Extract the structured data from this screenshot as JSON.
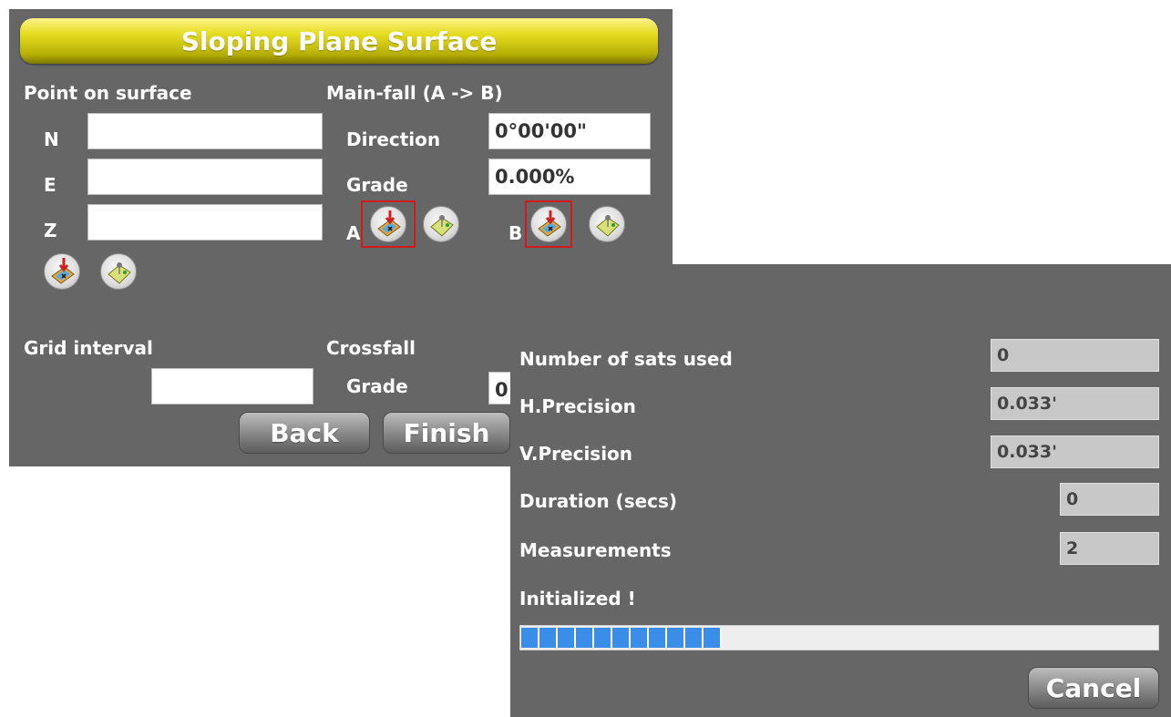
{
  "dialog_title": "Sloping Plane Surface",
  "point_section": {
    "heading": "Point on surface",
    "n_label": "N",
    "n_value": "",
    "e_label": "E",
    "e_value": "",
    "z_label": "Z",
    "z_value": ""
  },
  "mainfall": {
    "heading": "Main-fall (A -> B)",
    "direction_label": "Direction",
    "direction_value": "0°00'00\"",
    "grade_label": "Grade",
    "grade_value": "0.000%",
    "a_label": "A",
    "b_label": "B"
  },
  "grid": {
    "label": "Grid interval",
    "value": ""
  },
  "crossfall": {
    "heading": "Crossfall",
    "grade_label": "Grade",
    "grade_value": "0"
  },
  "buttons": {
    "back": "Back",
    "finish": "Finish",
    "cancel": "Cancel"
  },
  "measure_dialog": {
    "sats_label": "Number of sats used",
    "sats_value": "0",
    "hprec_label": "H.Precision",
    "hprec_value": "0.033'",
    "vprec_label": "V.Precision",
    "vprec_value": "0.033'",
    "duration_label": "Duration (secs)",
    "duration_value": "0",
    "measurements_label": "Measurements",
    "measurements_value": "2",
    "status": "Initialized !",
    "progress_fraction": 0.32
  },
  "icons": [
    "measure-point-icon",
    "select-point-icon"
  ],
  "colors": {
    "panel_bg": "#666666",
    "title_bar": "#d8d016",
    "progress": "#3a8ee8",
    "selection_outline": "#d11a1a"
  }
}
